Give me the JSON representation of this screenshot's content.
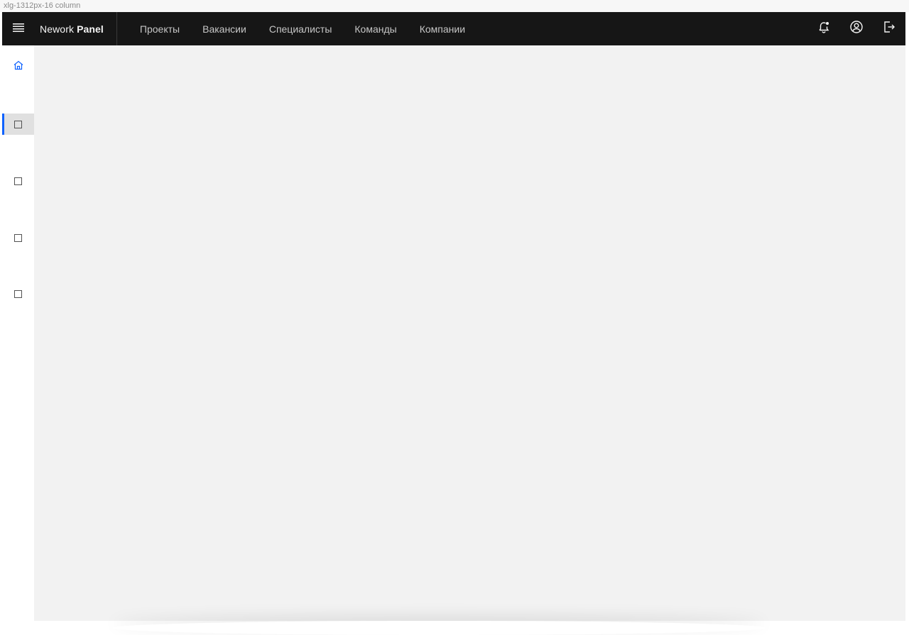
{
  "frame": {
    "label": "xlg-1312px-16 column"
  },
  "header": {
    "brand_light": "Nework",
    "brand_bold": "Panel",
    "nav": [
      {
        "label": "Проекты"
      },
      {
        "label": "Вакансии"
      },
      {
        "label": "Специалисты"
      },
      {
        "label": "Команды"
      },
      {
        "label": "Компании"
      }
    ],
    "actions": [
      "notification-icon",
      "user-avatar-icon",
      "logout-icon"
    ]
  },
  "sidebar": {
    "items": [
      {
        "icon": "home-icon",
        "active": false
      },
      {
        "icon": "square-icon",
        "active": true
      },
      {
        "icon": "square-icon",
        "active": false
      },
      {
        "icon": "square-icon",
        "active": false
      },
      {
        "icon": "square-icon",
        "active": false
      }
    ]
  },
  "colors": {
    "header_bg": "#161616",
    "nav_text": "#c6c6c6",
    "accent": "#0f62fe",
    "content_bg": "#f2f2f2",
    "sidebar_bg": "#ffffff",
    "active_item_bg": "#e0e0e0"
  }
}
